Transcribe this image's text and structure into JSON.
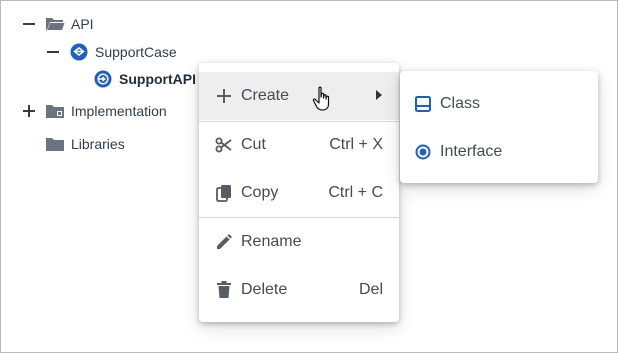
{
  "tree": {
    "nodes": [
      {
        "label": "API",
        "expander": "minus",
        "icon": "folder-open-icon"
      },
      {
        "label": "SupportCase",
        "expander": "minus",
        "icon": "package-icon"
      },
      {
        "label": "SupportAPI",
        "expander": "none",
        "icon": "interface-icon"
      },
      {
        "label": "Implementation",
        "expander": "plus",
        "icon": "folder-icon"
      },
      {
        "label": "Libraries",
        "expander": "none",
        "icon": "folder-icon"
      }
    ]
  },
  "context_menu": {
    "items": [
      {
        "label": "Create",
        "shortcut": "",
        "icon": "plus-icon",
        "has_submenu": true,
        "highlighted": true
      },
      {
        "label": "Cut",
        "shortcut": "Ctrl + X",
        "icon": "scissors-icon"
      },
      {
        "label": "Copy",
        "shortcut": "Ctrl + C",
        "icon": "copy-icon"
      },
      {
        "label": "Rename",
        "shortcut": "",
        "icon": "pencil-icon"
      },
      {
        "label": "Delete",
        "shortcut": "Del",
        "icon": "trash-icon"
      }
    ]
  },
  "submenu": {
    "items": [
      {
        "label": "Class",
        "icon": "class-icon"
      },
      {
        "label": "Interface",
        "icon": "interface-dot-icon"
      }
    ]
  },
  "colors": {
    "accent_blue": "#1f5fbf",
    "folder_gray": "#6b7380",
    "text": "#444b55",
    "hover_bg": "#eeeeee"
  }
}
